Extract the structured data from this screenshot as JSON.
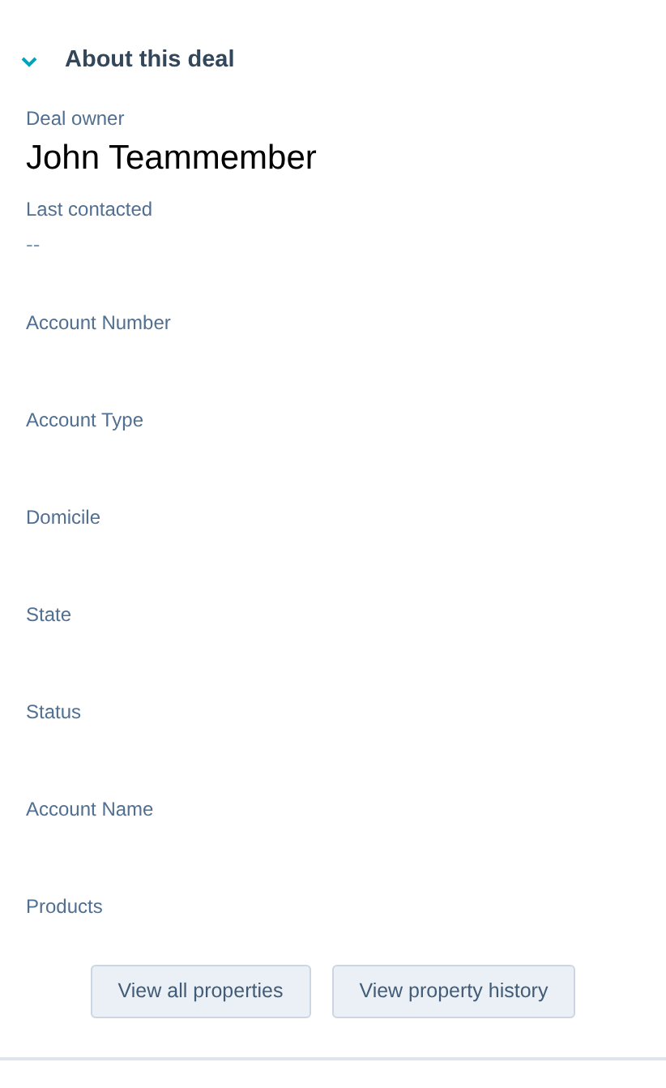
{
  "section": {
    "title": "About this deal",
    "expanded": true
  },
  "fields": [
    {
      "label": "Deal owner",
      "value": "John Teammember",
      "kind": "owner"
    },
    {
      "label": "Last contacted",
      "value": "--",
      "kind": "text"
    },
    {
      "label": "Account Number",
      "kind": "text"
    },
    {
      "label": "Account Type",
      "kind": "text"
    },
    {
      "label": "Domicile",
      "kind": "text"
    },
    {
      "label": "State",
      "kind": "text"
    },
    {
      "label": "Status",
      "kind": "text"
    },
    {
      "label": "Account Name",
      "kind": "text"
    },
    {
      "label": "Products",
      "kind": "text"
    }
  ],
  "buttons": [
    "View all properties",
    "View property history"
  ]
}
